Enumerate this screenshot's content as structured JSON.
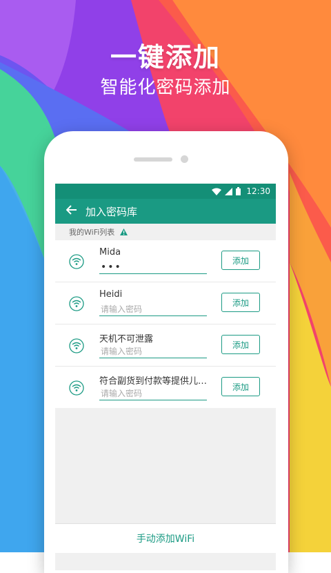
{
  "promo": {
    "headline": "一键添加",
    "subline": "智能化密码添加"
  },
  "statusbar": {
    "time": "12:30"
  },
  "appbar": {
    "title": "加入密码库"
  },
  "section": {
    "label": "我的WiFi列表"
  },
  "networks": [
    {
      "ssid": "Mida",
      "password": "•••",
      "placeholder": "",
      "button": "添加"
    },
    {
      "ssid": "Heidi",
      "password": "",
      "placeholder": "请输入密码",
      "button": "添加"
    },
    {
      "ssid": "天机不可泄露",
      "password": "",
      "placeholder": "请输入密码",
      "button": "添加"
    },
    {
      "ssid": "符合副货到付款等提供儿…",
      "password": "",
      "placeholder": "请输入密码",
      "button": "添加"
    }
  ],
  "footer": {
    "manual_add": "手动添加WiFi"
  },
  "colors": {
    "accent": "#1a9a83",
    "statusbar": "#148f77"
  }
}
